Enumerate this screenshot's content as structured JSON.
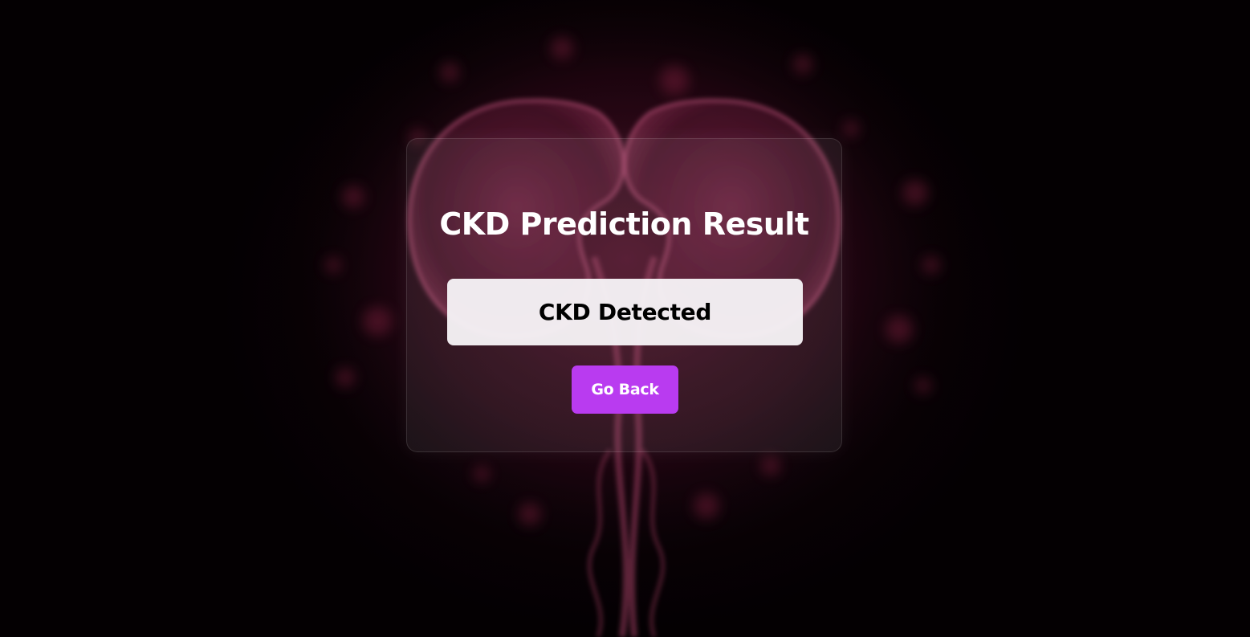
{
  "page": {
    "title": "CKD Prediction Result"
  },
  "result": {
    "label": "CKD Detected"
  },
  "actions": {
    "back_label": "Go Back"
  },
  "colors": {
    "background": "#070205",
    "card_background": "rgba(255,255,255,0.07)",
    "result_box": "#f6f3f6",
    "button": "#b93bf0",
    "title_text": "#ffffff",
    "result_text": "#000000",
    "art_accent": "#c2305e"
  },
  "background_image": {
    "icon": "kidneys-illustration"
  }
}
